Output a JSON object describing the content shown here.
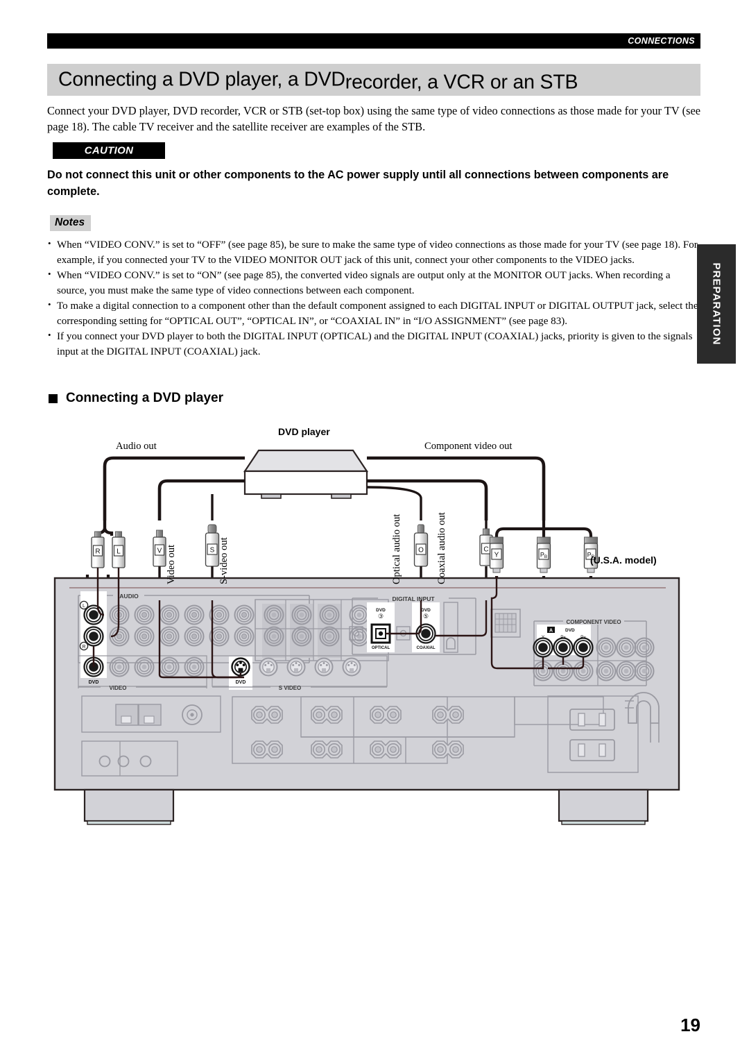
{
  "header": {
    "section_tab": "CONNECTIONS",
    "title_part1": "Connecting a DVD player, a DVD",
    "title_overlap": "recorder, a VCR or an STB"
  },
  "intro": "Connect your DVD player, DVD recorder, VCR or STB (set-top box) using the same type of video connections as those made for your TV (see page 18). The cable TV receiver and the satellite receiver are examples of the STB.",
  "caution": {
    "badge": "CAUTION",
    "text": "Do not connect this unit or other components to the AC power supply until all connections between components are complete."
  },
  "notes": {
    "badge": "Notes",
    "items": [
      "When “VIDEO CONV.” is set to “OFF” (see page 85), be sure to make the same type of video connections as those made for your TV (see page 18). For example, if you connected your TV to the VIDEO MONITOR OUT jack of this unit, connect your other components to the VIDEO jacks.",
      "When “VIDEO CONV.” is set to “ON” (see page 85), the converted video signals are output only at the MONITOR OUT jacks. When recording a source, you must make the same type of video connections between each component.",
      "To make a digital connection to a component other than the default component assigned to each DIGITAL INPUT or DIGITAL OUTPUT jack, select the corresponding setting for “OPTICAL OUT”, “OPTICAL IN”, or “COAXIAL IN” in “I/O ASSIGNMENT” (see page 83).",
      "If you connect your DVD player to both the DIGITAL INPUT (OPTICAL) and the DIGITAL INPUT (COAXIAL) jacks, priority is given to the signals input at the DIGITAL INPUT (COAXIAL) jack."
    ]
  },
  "side_tab": "PREPARATION",
  "subheading": "Connecting a DVD player",
  "diagram": {
    "device_label": "DVD player",
    "audio_out": "Audio out",
    "component_video_out": "Component video out",
    "usa_model": "(U.S.A. model)",
    "vertical_labels": {
      "video_out": "Video out",
      "s_video_out": "S-video out",
      "optical_audio_out": "Optical audio out",
      "coaxial_audio_out": "Coaxial audio out"
    },
    "plugs": {
      "right": "R",
      "left": "L",
      "video": "V",
      "s_video": "S",
      "optical": "O",
      "coaxial": "C",
      "comp_y": "Y",
      "comp_pb": "PB",
      "comp_pr": "PR"
    },
    "panel": {
      "audio_group": "AUDIO",
      "video_group": "VIDEO",
      "s_video_group": "S VIDEO",
      "digital_input_group": "DIGITAL INPUT",
      "component_video_group": "COMPONENT VIDEO",
      "audio_dvd": "DVD",
      "audio_left_mark": "L",
      "audio_right_mark": "R",
      "s_video_dvd": "DVD",
      "optical_dvd": "DVD",
      "optical_num": "③",
      "optical_label": "OPTICAL",
      "coaxial_dvd": "DVD",
      "coaxial_num": "⑤",
      "coaxial_label": "COAXIAL",
      "comp_letter": "A",
      "comp_dvd": "DVD",
      "comp_y": "Y",
      "comp_pb": "PB",
      "comp_pr": "PR"
    }
  },
  "page_number": "19"
}
